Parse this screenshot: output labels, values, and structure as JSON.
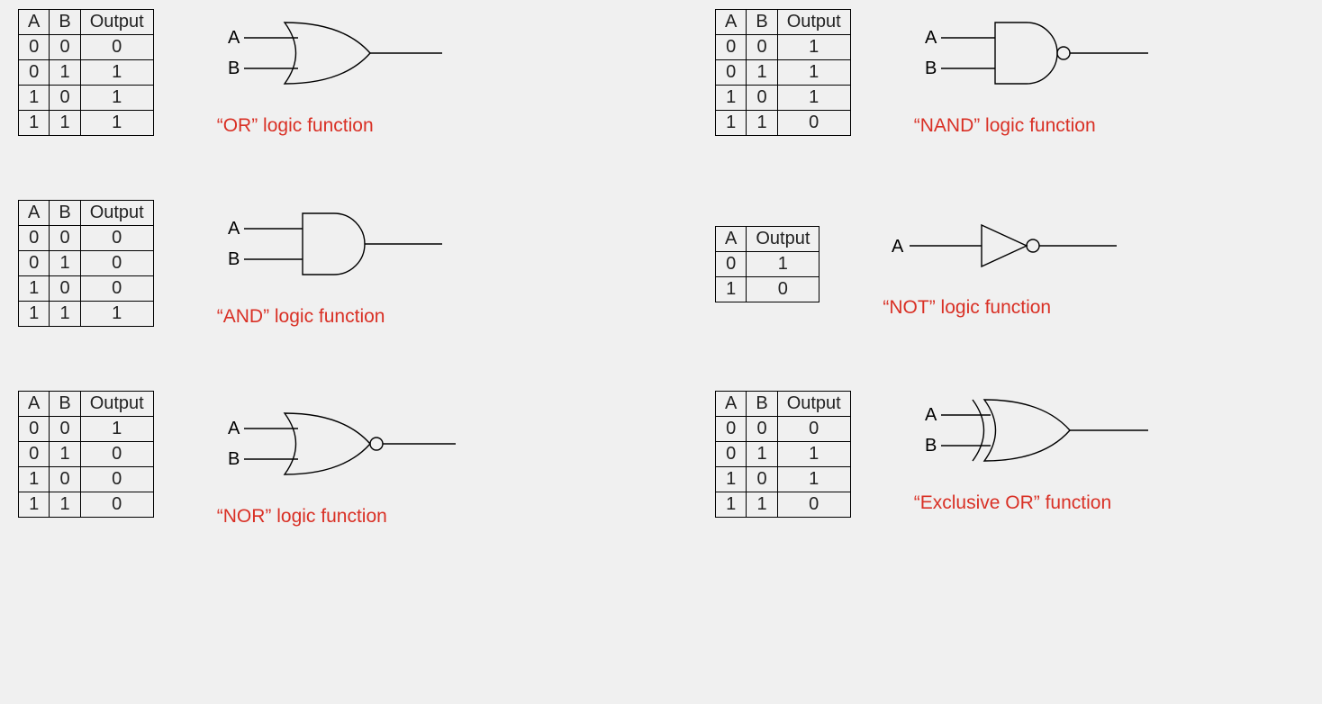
{
  "labels": {
    "A": "A",
    "B": "B",
    "Output": "Output"
  },
  "gates": {
    "or": {
      "caption": "“OR” logic function",
      "headers": [
        "A",
        "B",
        "Output"
      ],
      "rows": [
        [
          "0",
          "0",
          "0"
        ],
        [
          "0",
          "1",
          "1"
        ],
        [
          "1",
          "0",
          "1"
        ],
        [
          "1",
          "1",
          "1"
        ]
      ]
    },
    "nand": {
      "caption": "“NAND” logic function",
      "headers": [
        "A",
        "B",
        "Output"
      ],
      "rows": [
        [
          "0",
          "0",
          "1"
        ],
        [
          "0",
          "1",
          "1"
        ],
        [
          "1",
          "0",
          "1"
        ],
        [
          "1",
          "1",
          "0"
        ]
      ]
    },
    "and": {
      "caption": "“AND” logic function",
      "headers": [
        "A",
        "B",
        "Output"
      ],
      "rows": [
        [
          "0",
          "0",
          "0"
        ],
        [
          "0",
          "1",
          "0"
        ],
        [
          "1",
          "0",
          "0"
        ],
        [
          "1",
          "1",
          "1"
        ]
      ]
    },
    "not": {
      "caption": "“NOT” logic function",
      "headers": [
        "A",
        "Output"
      ],
      "rows": [
        [
          "0",
          "1"
        ],
        [
          "1",
          "0"
        ]
      ]
    },
    "nor": {
      "caption": "“NOR” logic function",
      "headers": [
        "A",
        "B",
        "Output"
      ],
      "rows": [
        [
          "0",
          "0",
          "1"
        ],
        [
          "0",
          "1",
          "0"
        ],
        [
          "1",
          "0",
          "0"
        ],
        [
          "1",
          "1",
          "0"
        ]
      ]
    },
    "xor": {
      "caption": "“Exclusive OR” function",
      "headers": [
        "A",
        "B",
        "Output"
      ],
      "rows": [
        [
          "0",
          "0",
          "0"
        ],
        [
          "0",
          "1",
          "1"
        ],
        [
          "1",
          "0",
          "1"
        ],
        [
          "1",
          "1",
          "0"
        ]
      ]
    }
  }
}
